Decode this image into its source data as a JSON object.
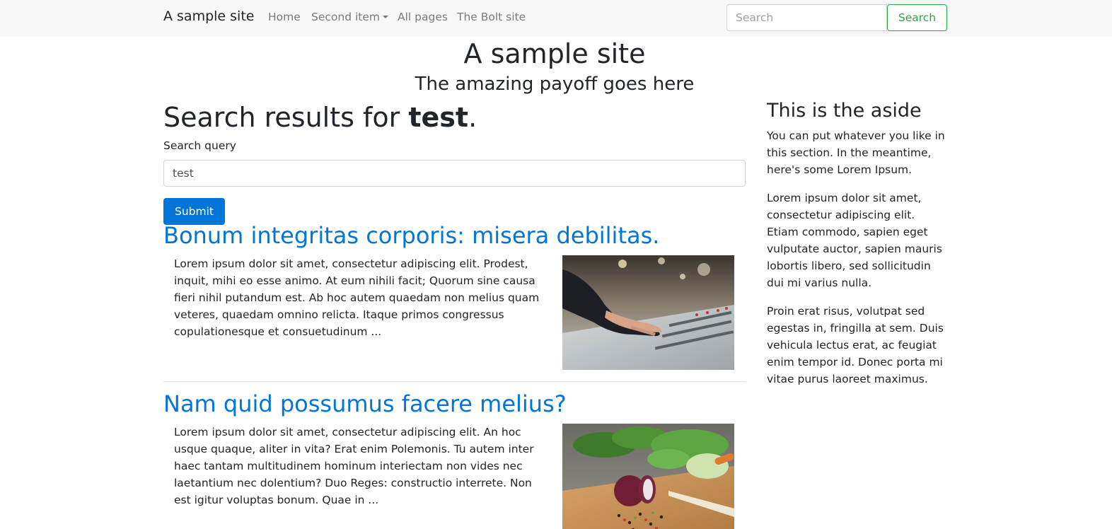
{
  "navbar": {
    "brand": "A sample site",
    "items": [
      {
        "label": "Home"
      },
      {
        "label": "Second item"
      },
      {
        "label": "All pages"
      },
      {
        "label": "The Bolt site"
      }
    ],
    "search_placeholder": "Search",
    "search_button": "Search"
  },
  "header": {
    "title": "A sample site",
    "payoff": "The amazing payoff goes here"
  },
  "search": {
    "heading_prefix": "Search results for ",
    "term": "test",
    "heading_suffix": ".",
    "label": "Search query",
    "value": "test",
    "submit_label": "Submit"
  },
  "results": [
    {
      "title": "Bonum integritas corporis: misera debilitas.",
      "excerpt": "Lorem ipsum dolor sit amet, consectetur adipiscing elit. Prodest, inquit, mihi eo esse animo. At eum nihili facit; Quorum sine causa fieri nihil putandum est. Ab hoc autem quaedam non melius quam veteres, quaedam omnino relicta. Itaque primos congressus copulationesque et consuetudinum ..."
    },
    {
      "title": "Nam quid possumus facere melius?",
      "excerpt": "Lorem ipsum dolor sit amet, consectetur adipiscing elit. An hoc usque quaque, aliter in vita? Erat enim Polemonis. Tu autem inter haec tantam multitudinem hominum interiectam non vides nec laetantium nec dolentium? Duo Reges: constructio interrete. Non est igitur voluptas bonum. Quae in ..."
    }
  ],
  "aside": {
    "title": "This is the aside",
    "paragraphs": [
      "You can put whatever you like in this section. In the meantime, here's some Lorem Ipsum.",
      "Lorem ipsum dolor sit amet, consectetur adipiscing elit. Etiam commodo, sapien eget vulputate auctor, sapien mauris lobortis libero, sed sollicitudin dui mi varius nulla.",
      "Proin erat risus, volutpat sed egestas in, fringilla at sem. Duis vehicula lectus erat, ac feugiat enim tempor id. Donec porta mi vitae purus laoreet maximus."
    ]
  },
  "colors": {
    "link": "#0275d8",
    "success": "#28a745",
    "navbar_bg": "#f8f8f8"
  }
}
